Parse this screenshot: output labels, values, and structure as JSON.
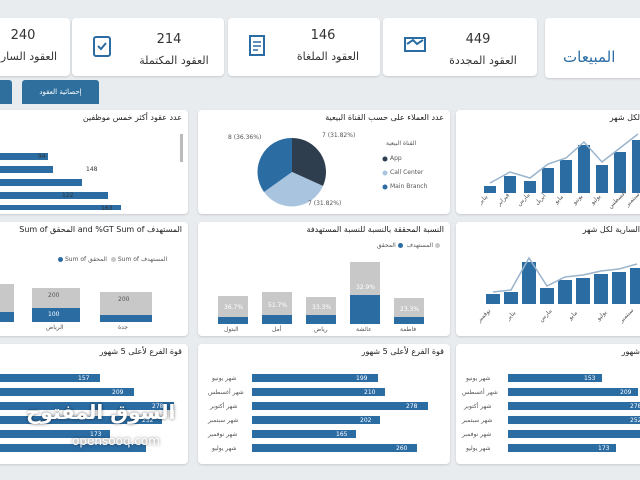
{
  "kpis": [
    {
      "value": "449",
      "label": "العقود المجددة"
    },
    {
      "value": "146",
      "label": "العقود الملغاة"
    },
    {
      "value": "214",
      "label": "العقود المكتملة"
    },
    {
      "value": "240",
      "label": "العقود السار"
    }
  ],
  "header_title": "المبيعات",
  "tabs": [
    {
      "label": "إحصائية العقود"
    }
  ],
  "panels": {
    "employees": {
      "title": "عدد عقود أكثر خمس موظفين",
      "values": [
        "94",
        "148",
        "122",
        "163"
      ]
    },
    "pie": {
      "title": "عدد العملاء على حسب القناة البيعية",
      "legend_title": "القناة البيعية",
      "items": [
        "App",
        "Call Center",
        "Main Branch"
      ],
      "labels": [
        "7 (31.82%)",
        "8 (36.36%)",
        "7 (31.82%)"
      ]
    },
    "monthly": {
      "title": "لكل شهر",
      "months": [
        "يناير",
        "فبراير",
        "مارس",
        "أبريل",
        "مايو",
        "يونيو",
        "يوليو",
        "أغسطس",
        "سبتمبر"
      ]
    },
    "gt": {
      "title": "المستهدف and %GT Sum of المحقق Sum of",
      "legend": [
        "Sum of المستهدف",
        "Sum of المحقق"
      ],
      "values": [
        "200",
        "100",
        "200"
      ],
      "cats": [
        "الرياض",
        "جدة"
      ]
    },
    "ratio": {
      "title": "النسبة المحققة بالنسبة للنسبة المستهدفة",
      "legend": [
        "المستهدف",
        "المحقق"
      ],
      "pcts": [
        "36.7%",
        "51.7%",
        "33.3%",
        "32.9%",
        "23.3%"
      ],
      "cats": [
        "البتول",
        "أمل",
        "رياض",
        "عائشة",
        "فاطمة"
      ]
    },
    "monthly2": {
      "title": "السارية لكل شهر",
      "months": [
        "نوفمبر",
        "يناير",
        "مارس",
        "مايو",
        "يوليو",
        "سبتمبر"
      ]
    },
    "branch_left": {
      "title": "قوة الفرع لأعلى 5 شهور",
      "values": [
        "157",
        "209",
        "278",
        "252",
        "173"
      ]
    },
    "branch_mid": {
      "title": "قوة الفرع لأعلى 5 شهور",
      "months": [
        "شهر يونيو",
        "شهر أغسطس",
        "شهر أكتوبر",
        "شهر سبتمبر",
        "شهر نوفمبر",
        "شهر يوليو"
      ],
      "values": [
        "199",
        "210",
        "278",
        "202",
        "165",
        "260"
      ]
    },
    "branch_right": {
      "title": "شهور",
      "months": [
        "شهر يونيو",
        "شهر أغسطس",
        "شهر أكتوبر",
        "شهر سبتمبر",
        "شهر نوفمبر",
        "شهر يوليو"
      ],
      "values": [
        "153",
        "209",
        "278",
        "252",
        "173"
      ]
    }
  },
  "watermark": {
    "arabic": "السوق المفتوح",
    "latin": "opensooq.com"
  },
  "colors": {
    "accent": "#2b6ca3",
    "gray": "#c8c8c8",
    "dark": "#2f3e4e",
    "light": "#a9c4de"
  }
}
